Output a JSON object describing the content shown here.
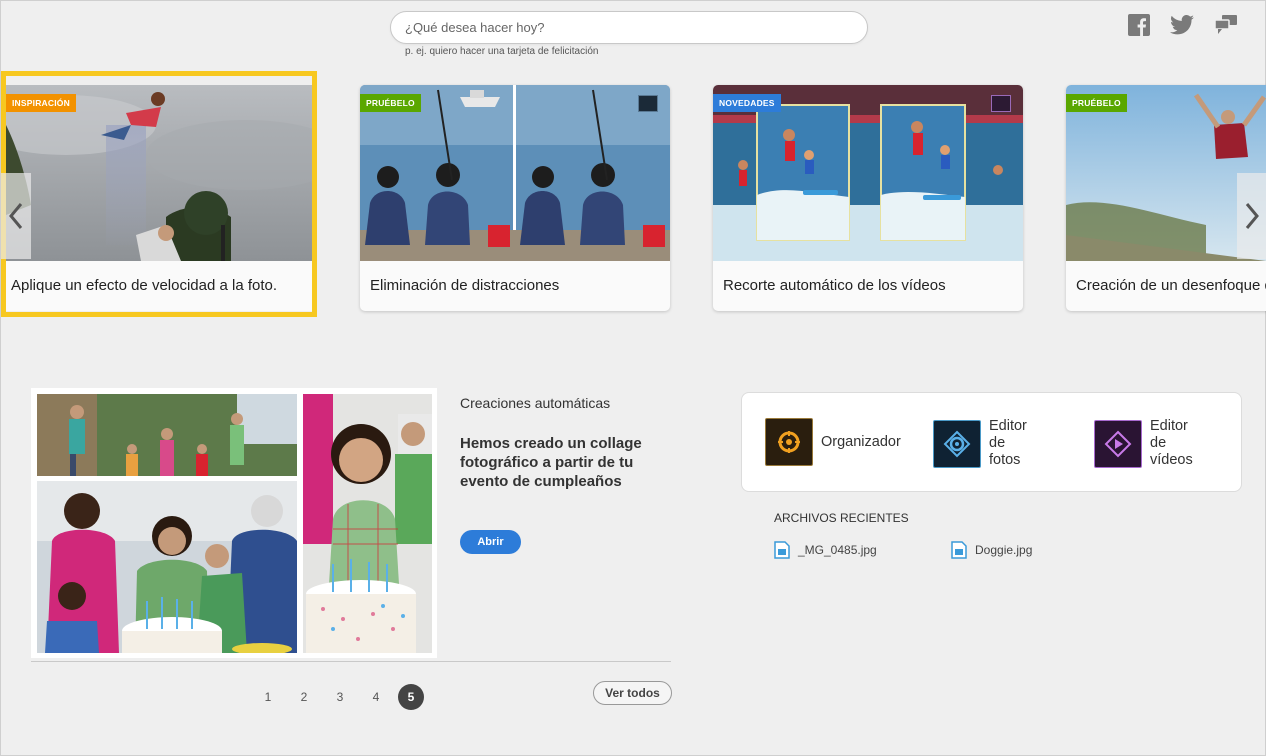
{
  "search": {
    "placeholder": "¿Qué desea hacer hoy?",
    "hint": "p. ej. quiero hacer una tarjeta de felicitación"
  },
  "social": [
    {
      "name": "facebook"
    },
    {
      "name": "twitter"
    },
    {
      "name": "feedback"
    }
  ],
  "carousel": {
    "cards": [
      {
        "badge": "INSPIRACIÓN",
        "badge_color": "#f39200",
        "caption": "Aplique un efecto de velocidad a la foto.",
        "selected": true
      },
      {
        "badge": "PRUÉBELO",
        "badge_color": "#5aa700",
        "caption": "Eliminación de distracciones"
      },
      {
        "badge": "NOVEDADES",
        "badge_color": "#2d7cd9",
        "caption": "Recorte automático de los vídeos"
      },
      {
        "badge": "PRUÉBELO",
        "badge_color": "#5aa700",
        "caption": "Creación de un desenfoque de"
      }
    ]
  },
  "creation": {
    "title": "Creaciones automáticas",
    "description": "Hemos creado un collage fotográfico a partir de tu evento de cumpleaños",
    "open_label": "Abrir"
  },
  "pagination": {
    "pages": [
      "1",
      "2",
      "3",
      "4",
      "5"
    ],
    "active": "5",
    "see_all_label": "Ver todos"
  },
  "apps": [
    {
      "label": "Organizador",
      "icon": "organizer-icon"
    },
    {
      "label": "Editor de fotos",
      "label_lines": [
        "Editor",
        "de",
        "fotos"
      ],
      "icon": "photo-editor-icon"
    },
    {
      "label": "Editor de vídeos",
      "label_lines": [
        "Editor",
        "de",
        "vídeos"
      ],
      "icon": "video-editor-icon"
    }
  ],
  "recent": {
    "title": "ARCHIVOS RECIENTES",
    "files": [
      "_MG_0485.jpg",
      "Doggie.jpg"
    ]
  },
  "colors": {
    "accent": "#2d7cd9",
    "selection": "#f7c820",
    "orange_badge": "#f39200",
    "green_badge": "#5aa700"
  }
}
